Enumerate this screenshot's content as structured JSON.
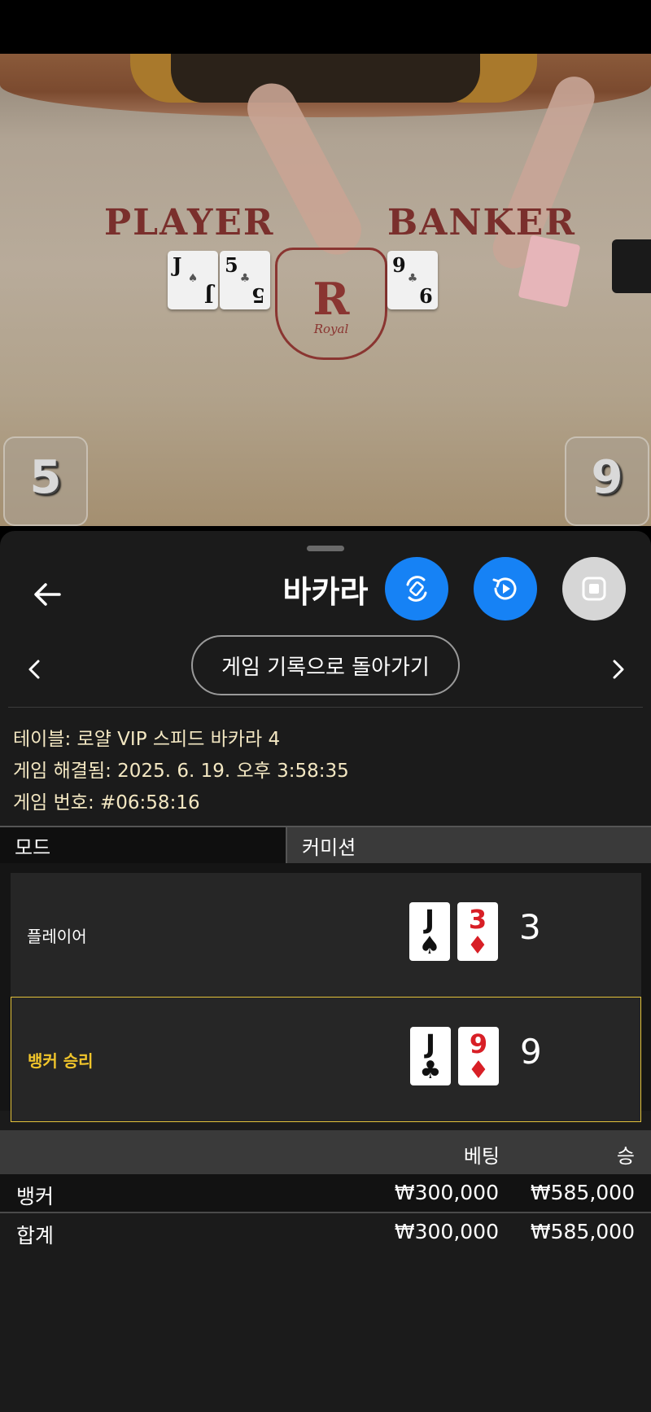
{
  "video": {
    "felt_player": "PLAYER",
    "felt_banker": "BANKER",
    "crest_letter": "R",
    "crest_word": "Royal",
    "player_cards": [
      {
        "rank": "J",
        "suit": "♠"
      },
      {
        "rank": "5",
        "suit": "♣"
      }
    ],
    "banker_cards": [
      {
        "rank": "9",
        "suit": "♣"
      }
    ],
    "player_score": "5",
    "banker_score": "9"
  },
  "header": {
    "title": "바카라",
    "back_icon": "arrow-left-icon",
    "buttons": [
      {
        "name": "rotate-icon",
        "color": "#1682f5"
      },
      {
        "name": "replay-icon",
        "color": "#1682f5"
      },
      {
        "name": "stop-icon",
        "color": "#d6d6d6"
      }
    ]
  },
  "history": {
    "back_label": "게임 기록으로 돌아가기",
    "prev_icon": "chevron-left-icon",
    "next_icon": "chevron-right-icon"
  },
  "info": {
    "table": "테이블: 로얄 VIP 스피드 바카라 4",
    "resolved": "게임 해결됨: 2025. 6. 19. 오후 3:58:35",
    "game_number": "게임 번호: #06:58:16"
  },
  "mode": {
    "active_tab": "모드",
    "commission_tab": "커미션"
  },
  "results": {
    "player": {
      "label": "플레이어",
      "cards": [
        {
          "rank": "J",
          "suit": "♠",
          "color": "black"
        },
        {
          "rank": "3",
          "suit": "♦",
          "color": "red"
        }
      ],
      "total": "3"
    },
    "banker": {
      "label": "뱅커 승리",
      "cards": [
        {
          "rank": "J",
          "suit": "♣",
          "color": "black"
        },
        {
          "rank": "9",
          "suit": "♦",
          "color": "red"
        }
      ],
      "total": "9"
    },
    "winner_color": "#f1c52b"
  },
  "bets": {
    "header_bet": "베팅",
    "header_win": "승",
    "rows": [
      {
        "name": "뱅커",
        "bet": "₩300,000",
        "win": "₩585,000"
      },
      {
        "name": "합계",
        "bet": "₩300,000",
        "win": "₩585,000"
      }
    ]
  }
}
